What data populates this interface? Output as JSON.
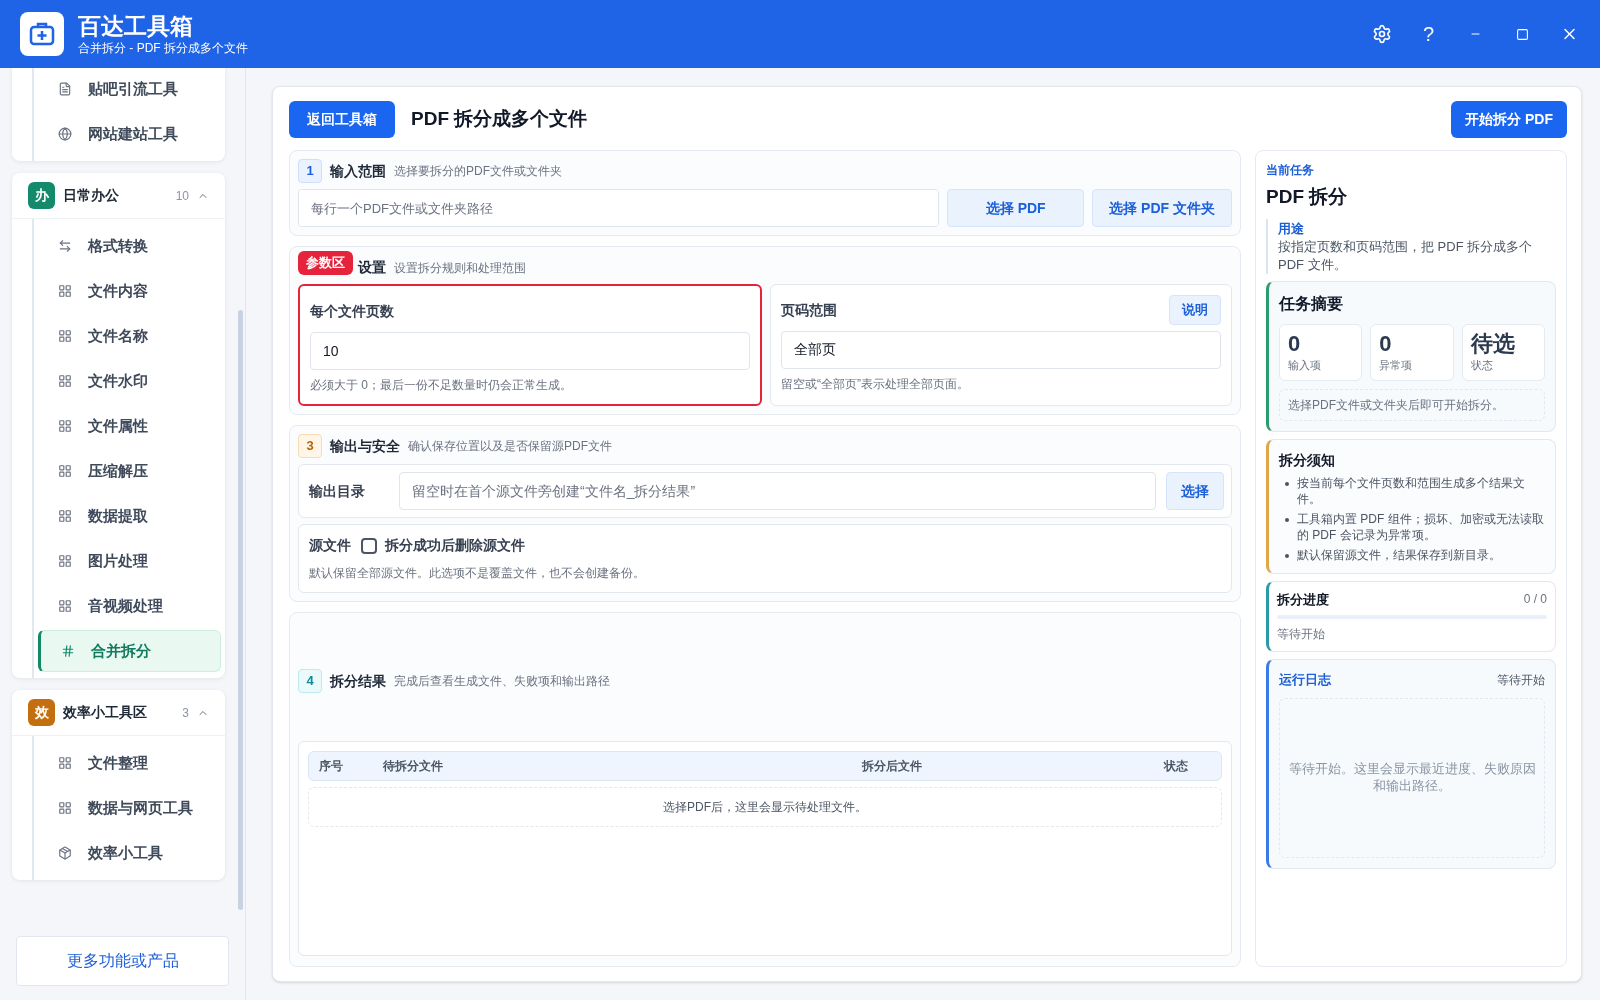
{
  "app": {
    "title": "百达工具箱",
    "subtitle": "合并拆分 - PDF 拆分成多个文件",
    "help": "?"
  },
  "sidebar": {
    "groups": [
      {
        "items": [
          {
            "label": "贴吧引流工具",
            "kind": "doc",
            "selected": false
          },
          {
            "label": "网站建站工具",
            "kind": "globe",
            "selected": false
          }
        ]
      },
      {
        "badge": "办",
        "color": "#138a6c",
        "title": "日常办公",
        "count": "10",
        "expanded": true,
        "items": [
          {
            "label": "格式转换",
            "kind": "swap",
            "selected": false
          },
          {
            "label": "文件内容",
            "kind": "grid",
            "selected": false
          },
          {
            "label": "文件名称",
            "kind": "grid",
            "selected": false
          },
          {
            "label": "文件水印",
            "kind": "grid",
            "selected": false
          },
          {
            "label": "文件属性",
            "kind": "grid",
            "selected": false
          },
          {
            "label": "压缩解压",
            "kind": "grid",
            "selected": false
          },
          {
            "label": "数据提取",
            "kind": "grid",
            "selected": false
          },
          {
            "label": "图片处理",
            "kind": "grid",
            "selected": false
          },
          {
            "label": "音视频处理",
            "kind": "grid",
            "selected": false
          },
          {
            "label": "合并拆分",
            "kind": "hash",
            "selected": true
          }
        ]
      },
      {
        "badge": "效",
        "color": "#c46f0f",
        "title": "效率小工具区",
        "count": "3",
        "expanded": true,
        "items": [
          {
            "label": "文件整理",
            "kind": "grid",
            "selected": false
          },
          {
            "label": "数据与网页工具",
            "kind": "grid",
            "selected": false
          },
          {
            "label": "效率小工具",
            "kind": "box",
            "selected": false
          }
        ]
      }
    ],
    "more_button": "更多功能或产品"
  },
  "toolbar": {
    "back_button": "返回工具箱",
    "title": "PDF 拆分成多个文件",
    "start_button": "开始拆分 PDF"
  },
  "input_section": {
    "number": "1",
    "title": "输入范围",
    "hint": "选择要拆分的PDF文件或文件夹",
    "placeholder": "每行一个PDF文件或文件夹路径",
    "buttons": [
      "选择 PDF",
      "选择 PDF 文件夹"
    ]
  },
  "params_section": {
    "tag": "参数区",
    "title": "设置",
    "hint": "设置拆分规则和处理范围",
    "fields": [
      {
        "label": "每个文件页数",
        "value": "10",
        "note": "必须大于 0；最后一份不足数量时仍会正常生成。",
        "highlighted": true
      },
      {
        "label": "页码范围",
        "value": "全部页",
        "note": "留空或“全部页”表示处理全部页面。",
        "button": "说明",
        "highlighted": false
      }
    ]
  },
  "output_section": {
    "number": "3",
    "title": "输出与安全",
    "hint": "确认保存位置以及是否保留源PDF文件",
    "dir_label": "输出目录",
    "dir_placeholder": "留空时在首个源文件旁创建“文件名_拆分结果”",
    "dir_button": "选择",
    "source_label": "源文件",
    "delete_option": {
      "label": "拆分成功后删除源文件",
      "checked": false
    },
    "source_note": "默认保留全部源文件。此选项不是覆盖文件，也不会创建备份。"
  },
  "result_section": {
    "number": "4",
    "title": "拆分结果",
    "hint": "完成后查看生成文件、失败项和输出路径",
    "table": {
      "columns": [
        "序号",
        "待拆分文件",
        "拆分后文件",
        "状态"
      ],
      "empty": "选择PDF后，这里会显示待处理文件。"
    }
  },
  "task_panel": {
    "label": "当前任务",
    "title": "PDF 拆分",
    "purpose_label": "用途",
    "purpose": "按指定页数和页码范围，把 PDF 拆分成多个 PDF 文件。",
    "summary": {
      "title": "任务摘要",
      "stats": [
        {
          "value": "0",
          "label": "输入项"
        },
        {
          "value": "0",
          "label": "异常项"
        },
        {
          "value": "待选",
          "label": "状态"
        }
      ],
      "note": "选择PDF文件或文件夹后即可开始拆分。"
    },
    "notice": {
      "title": "拆分须知",
      "items": [
        "按当前每个文件页数和范围生成多个结果文件。",
        "工具箱内置 PDF 组件；损坏、加密或无法读取的 PDF 会记录为异常项。",
        "默认保留源文件，结果保存到新目录。"
      ]
    },
    "progress": {
      "title": "拆分进度",
      "count": "0 / 0",
      "level": 0,
      "status": "等待开始"
    },
    "log": {
      "title": "运行日志",
      "status": "等待开始",
      "empty": "等待开始。这里会显示最近进度、失败原因和输出路径。"
    }
  }
}
